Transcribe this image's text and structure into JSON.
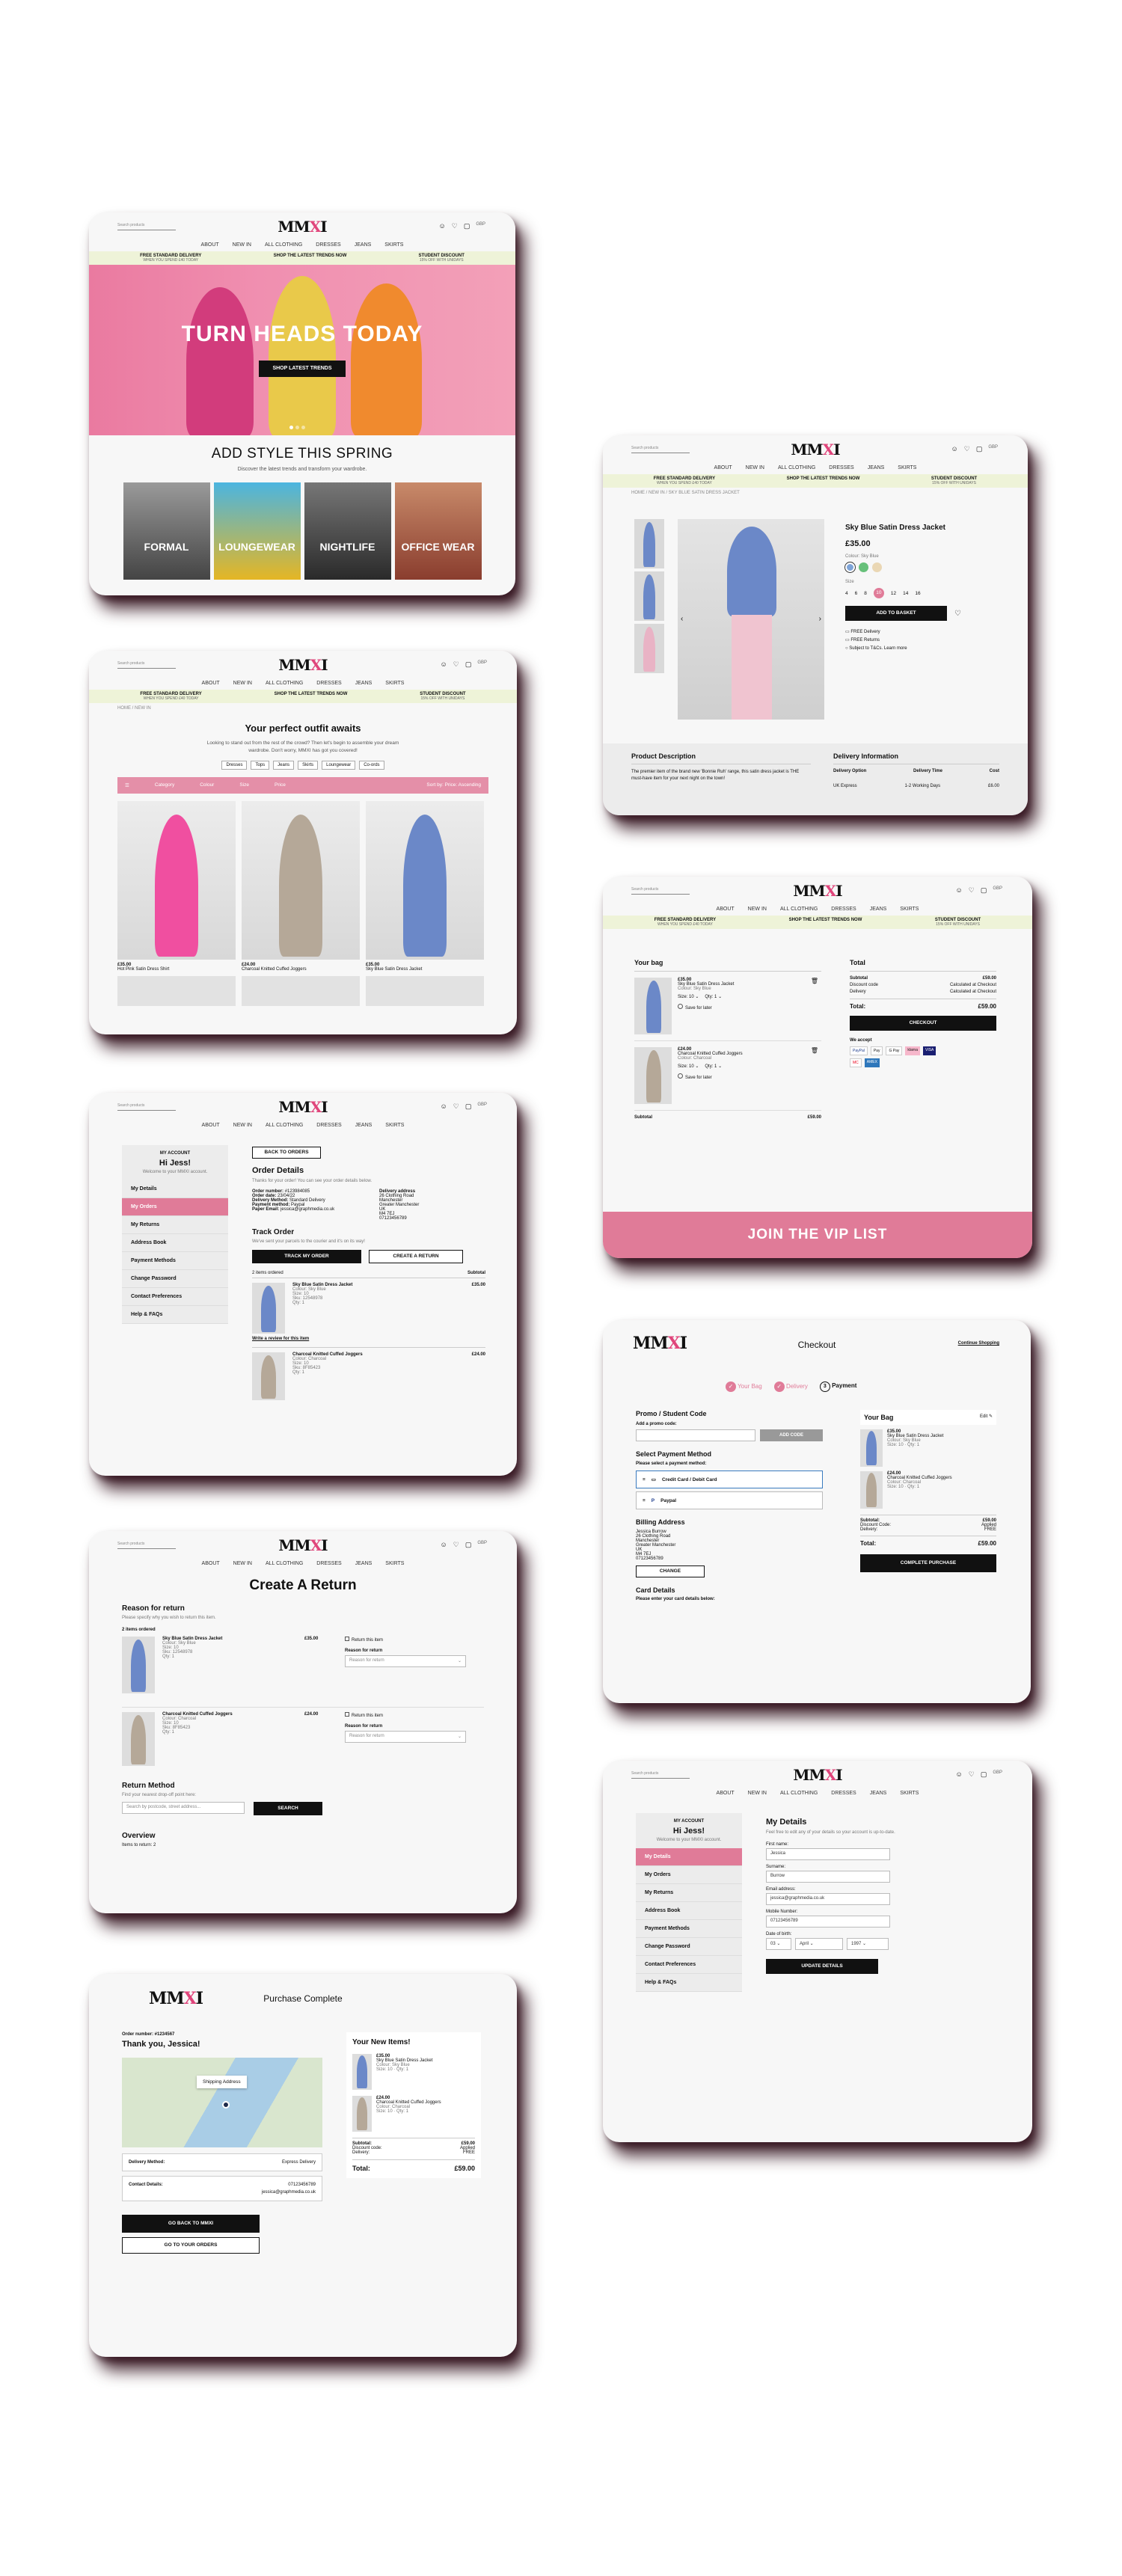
{
  "brand": {
    "logo": "MMXI",
    "search_placeholder": "Search products",
    "currency": "GBP"
  },
  "nav": [
    "ABOUT",
    "NEW IN",
    "ALL CLOTHING",
    "DRESSES",
    "JEANS",
    "SKIRTS"
  ],
  "promo": [
    {
      "title": "FREE STANDARD DELIVERY",
      "sub": "WHEN YOU SPEND £40 TODAY"
    },
    {
      "title": "SHOP THE LATEST TRENDS NOW",
      "sub": ""
    },
    {
      "title": "STUDENT DISCOUNT",
      "sub": "15% OFF WITH UNIDAYS"
    }
  ],
  "home": {
    "hero_title": "TURN HEADS TODAY",
    "hero_btn": "SHOP LATEST TRENDS",
    "section_title": "ADD STYLE THIS SPRING",
    "section_sub": "Discover the latest trends and transform your wardrobe.",
    "tiles": [
      "FORMAL",
      "LOUNGEWEAR",
      "NIGHTLIFE",
      "OFFICE WEAR"
    ]
  },
  "listing": {
    "crumb": "HOME / NEW IN",
    "title": "Your perfect outfit awaits",
    "desc": "Looking to stand out from the rest of the crowd? Then let's begin to assemble your dream wardrobe. Don't worry, MMXI has got you covered!",
    "chips": [
      "Dresses",
      "Tops",
      "Jeans",
      "Skirts",
      "Loungewear",
      "Co-ords"
    ],
    "filters": [
      "Category",
      "Colour",
      "Size",
      "Price"
    ],
    "sort": "Sort by: Price: Ascending",
    "products": [
      {
        "price": "£35.00",
        "name": "Hot Pink Satin Dress Shirt"
      },
      {
        "price": "£24.00",
        "name": "Charcoal Knitted Cuffed Joggers"
      },
      {
        "price": "£35.00",
        "name": "Sky Blue Satin Dress Jacket"
      }
    ]
  },
  "pdp": {
    "crumb": "HOME / NEW IN / SKY BLUE SATIN DRESS JACKET",
    "name": "Sky Blue Satin Dress Jacket",
    "price": "£35.00",
    "colour": "Colour: Sky Blue",
    "size_label": "Size",
    "sizes": [
      "4",
      "6",
      "8",
      "10",
      "12",
      "14",
      "16"
    ],
    "add": "ADD TO BASKET",
    "perks": [
      "FREE Delivery",
      "FREE Returns",
      "Subject to T&Cs. Learn more"
    ],
    "desc_title": "Product Description",
    "desc": "The premier item of the brand new 'Bonnie Ruh' range, this satin dress jacket is THE must-have item for your next night on the town!",
    "deliv_title": "Delivery Information",
    "deliv_head": [
      "Delivery Option",
      "Delivery Time",
      "Cost"
    ],
    "deliv_row": [
      "UK Express",
      "1-2 Working Days",
      "£6.00"
    ]
  },
  "bag": {
    "title": "Your bag",
    "items": [
      {
        "price": "£35.00",
        "name": "Sky Blue Satin Dress Jacket",
        "colour": "Colour: Sky Blue",
        "size": "Size: 10",
        "qty": "Qty: 1"
      },
      {
        "price": "£24.00",
        "name": "Charcoal Knitted Cuffed Joggers",
        "colour": "Colour: Charcoal",
        "size": "Size: 10",
        "qty": "Qty: 1"
      }
    ],
    "save": "Save for later",
    "subtotal_label": "Subtotal",
    "subtotal": "£59.00",
    "total_title": "Total",
    "rows": [
      [
        "Subtotal",
        "£59.00"
      ],
      [
        "Discount code",
        "Calculated at Checkout"
      ],
      [
        "Delivery",
        "Calculated at Checkout"
      ]
    ],
    "total": "£59.00",
    "total_label": "Total:",
    "checkout": "CHECKOUT",
    "accept": "We accept",
    "pay": [
      "PayPal",
      "Pay",
      "G Pay",
      "klarna",
      "VISA",
      "MC",
      "AMEX"
    ],
    "vip": "JOIN THE VIP LIST"
  },
  "order": {
    "back": "BACK TO ORDERS",
    "title": "Order Details",
    "thanks": "Thanks for your order! You can see your order details below.",
    "fields": [
      [
        "Order number:",
        "#123984085"
      ],
      [
        "Order date:",
        "23/04/22"
      ],
      [
        "Delivery Method:",
        "Standard Delivery"
      ],
      [
        "Payment method:",
        "Paypal"
      ],
      [
        "Paper Email:",
        "jessica@graphmedia.co.uk"
      ]
    ],
    "addr_title": "Delivery address",
    "addr": [
      "26 Clothing Road",
      "Manchester",
      "Greater Manchester",
      "UK",
      "M4 7EJ",
      "07123456789"
    ],
    "track_title": "Track Order",
    "track_text": "We've sent your parcels to the courier and it's on its way!",
    "track_btn": "TRACK MY ORDER",
    "return_btn": "CREATE A RETURN",
    "items_label": "2 items ordered",
    "subtotal_label": "Subtotal",
    "items": [
      {
        "name": "Sky Blue Satin Dress Jacket",
        "colour": "Colour: Sky Blue",
        "size": "Size: 10",
        "sku": "Sku: 12548978",
        "qty": "Qty: 1",
        "price": "£35.00"
      },
      {
        "name": "Charcoal Knitted Cuffed Joggers",
        "colour": "Colour: Charcoal",
        "size": "Size: 10",
        "sku": "Sku: 8F85423",
        "qty": "Qty: 1",
        "price": "£24.00"
      }
    ],
    "review": "Write a review for this item"
  },
  "account": {
    "title": "MY ACCOUNT",
    "hi": "Hi Jess!",
    "welcome": "Welcome to your MMXI account.",
    "menu": [
      "My Details",
      "My Orders",
      "My Returns",
      "Address Book",
      "Payment Methods",
      "Change Password",
      "Contact Preferences",
      "Help & FAQs"
    ]
  },
  "details": {
    "title": "My Details",
    "intro": "Feel free to edit any of your details so your account is up-to-date.",
    "fields": [
      [
        "First name:",
        "Jessica"
      ],
      [
        "Surname:",
        "Burrow"
      ],
      [
        "Email address:",
        "jessica@graphmedia.co.uk"
      ],
      [
        "Mobile Number:",
        "07123456789"
      ]
    ],
    "dob_label": "Date of birth:",
    "dob": [
      "03",
      "April",
      "1997"
    ],
    "update": "UPDATE DETAILS"
  },
  "returns": {
    "title": "Create A Return",
    "reason_title": "Reason for return",
    "reason_text": "Please specify why you wish to return this item.",
    "items_label": "2 items ordered",
    "return_item": "Return this item",
    "reason_label": "Reason for return",
    "reason_ph": "Reason for return",
    "method_title": "Return Method",
    "method_text": "Find your nearest drop-off point here:",
    "method_ph": "Search by postcode, street address...",
    "search": "SEARCH",
    "overview": "Overview",
    "overview_text": "Items to return: 2"
  },
  "checkout": {
    "title": "Checkout",
    "cont": "Continue Shopping",
    "steps": [
      "Your Bag",
      "Delivery",
      "Payment"
    ],
    "step_num": "3",
    "promo_title": "Promo / Student Code",
    "promo_label": "Add a promo code:",
    "promo_btn": "ADD CODE",
    "pay_title": "Select Payment Method",
    "pay_label": "Please select a payment method:",
    "pay_opts": [
      "Credit Card / Debit Card",
      "Paypal"
    ],
    "bill_title": "Billing Address",
    "bill": [
      "Jessica Burrow",
      "26 Clothing Road",
      "Manchester",
      "Greater Manchester",
      "UK",
      "M4 7EJ",
      "07123456789"
    ],
    "change": "CHANGE",
    "card_title": "Card Details",
    "card_text": "Please enter your card details below:",
    "bag_title": "Your Bag",
    "edit": "Edit",
    "rows": [
      [
        "Subtotal:",
        "£59.00"
      ],
      [
        "Discount Code:",
        "Applied"
      ],
      [
        "Delivery:",
        "FREE"
      ]
    ],
    "total_label": "Total:",
    "total": "£59.00",
    "complete": "COMPLETE PURCHASE"
  },
  "complete": {
    "title": "Purchase Complete",
    "order_no": "Order number: #1234567",
    "thanks": "Thank you, Jessica!",
    "map_label": "Shipping Address",
    "rows": [
      [
        "Delivery Method:",
        "Express Delivery"
      ],
      [
        "Contact Details:",
        "07123456789"
      ]
    ],
    "email": "jessica@graphmedia.co.uk",
    "btn1": "GO BACK TO MMXI",
    "btn2": "GO TO YOUR ORDERS",
    "new_title": "Your New Items!",
    "sum": [
      [
        "Subtotal:",
        "£59.00"
      ],
      [
        "Discount code:",
        "Applied"
      ],
      [
        "Delivery:",
        "FREE"
      ]
    ],
    "total_label": "Total:",
    "total": "£59.00"
  },
  "colors": {
    "accent": "#e07b98",
    "promo_bg": "#eef3d8",
    "shadow": "#2a0612"
  }
}
